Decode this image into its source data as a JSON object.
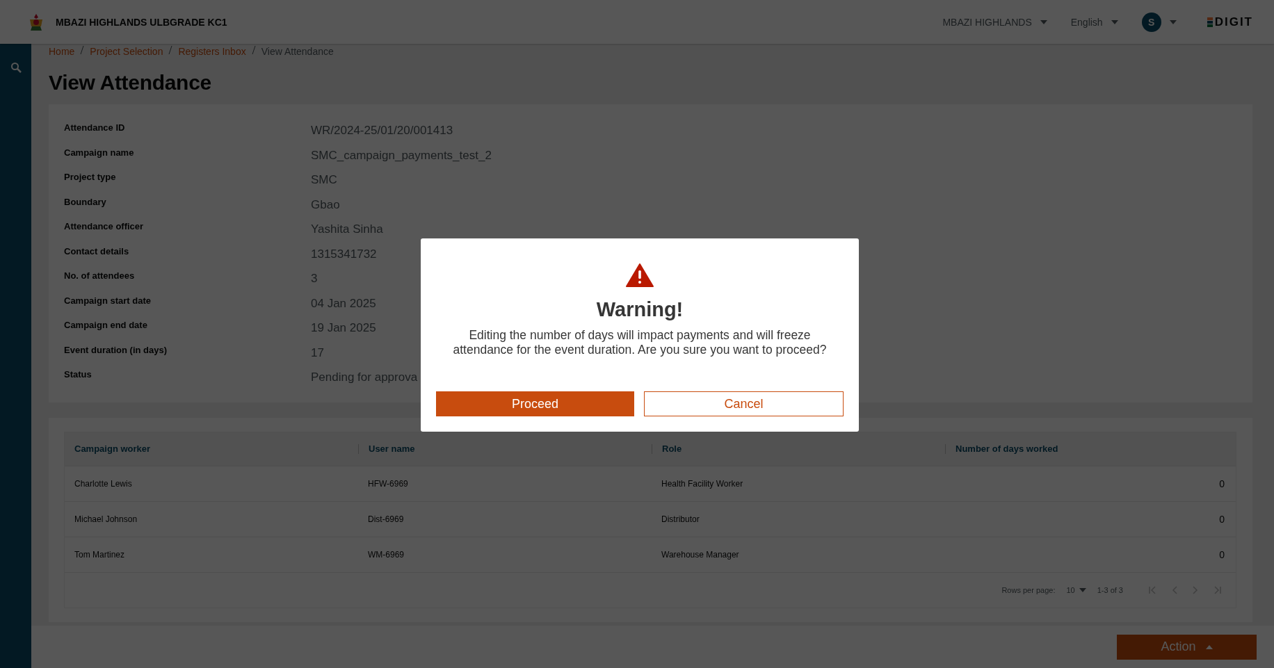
{
  "header": {
    "title": "MBAZI HIGHLANDS ULBGRADE KC1",
    "tenant": "MBAZI HIGHLANDS",
    "language": "English",
    "avatar": "S",
    "brand": "DIGIT"
  },
  "breadcrumb": [
    {
      "label": "Home",
      "link": true
    },
    {
      "label": "Project Selection",
      "link": true
    },
    {
      "label": "Registers Inbox",
      "link": true
    },
    {
      "label": "View Attendance",
      "link": false
    }
  ],
  "page_title": "View Attendance",
  "details": [
    {
      "label": "Attendance ID",
      "value": "WR/2024-25/01/20/001413"
    },
    {
      "label": "Campaign name",
      "value": "SMC_campaign_payments_test_2"
    },
    {
      "label": "Project type",
      "value": "SMC"
    },
    {
      "label": "Boundary",
      "value": "Gbao"
    },
    {
      "label": "Attendance officer",
      "value": "Yashita Sinha"
    },
    {
      "label": "Contact details",
      "value": "1315341732"
    },
    {
      "label": "No. of attendees",
      "value": "3"
    },
    {
      "label": "Campaign start date",
      "value": "04 Jan 2025"
    },
    {
      "label": "Campaign end date",
      "value": "19 Jan 2025"
    },
    {
      "label": "Event duration (in days)",
      "value": "17"
    },
    {
      "label": "Status",
      "value": "Pending for approva"
    }
  ],
  "table": {
    "columns": [
      "Campaign worker",
      "User name",
      "Role",
      "Number of days worked"
    ],
    "rows": [
      [
        "Charlotte Lewis",
        "HFW-6969",
        "Health Facility Worker",
        "0"
      ],
      [
        "Michael Johnson",
        "Dist-6969",
        "Distributor",
        "0"
      ],
      [
        "Tom Martinez",
        "WM-6969",
        "Warehouse Manager",
        "0"
      ]
    ]
  },
  "pagination": {
    "rows_per_page_label": "Rows per page:",
    "rows_per_page": "10",
    "range": "1-3 of 3"
  },
  "action_button": "Action",
  "dialog": {
    "title": "Warning!",
    "message": "Editing the number of days will impact payments and will freeze attendance for the event duration.  Are you sure you want to proceed?",
    "buttons": [
      {
        "label": "Proceed",
        "kind": "primary"
      },
      {
        "label": "Cancel",
        "kind": "secondary"
      }
    ]
  }
}
